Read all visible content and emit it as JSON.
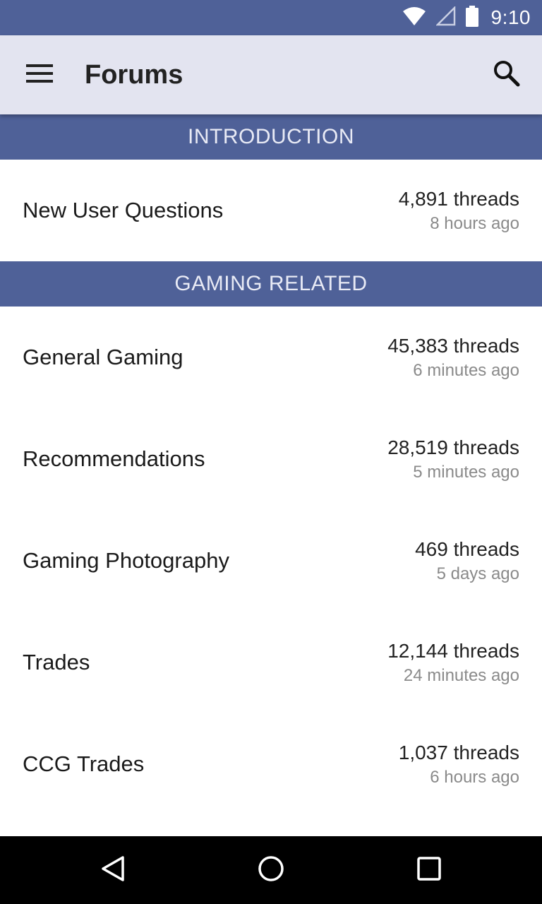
{
  "status_bar": {
    "time": "9:10",
    "icons": [
      "wifi-icon",
      "cell-signal-icon",
      "battery-icon"
    ]
  },
  "app_bar": {
    "title": "Forums",
    "menu_icon": "hamburger-menu-icon",
    "search_icon": "search-icon"
  },
  "colors": {
    "primary": "#4f6198",
    "app_bar_bg": "#e3e4f0",
    "secondary_text": "#8a8a8a"
  },
  "sections": [
    {
      "title": "INTRODUCTION",
      "forums": [
        {
          "name": "New User Questions",
          "threads": "4,891 threads",
          "last_post": "8 hours ago"
        }
      ]
    },
    {
      "title": "GAMING RELATED",
      "forums": [
        {
          "name": "General Gaming",
          "threads": "45,383 threads",
          "last_post": "6 minutes ago"
        },
        {
          "name": "Recommendations",
          "threads": "28,519 threads",
          "last_post": "5 minutes ago"
        },
        {
          "name": "Gaming Photography",
          "threads": "469 threads",
          "last_post": "5 days ago"
        },
        {
          "name": "Trades",
          "threads": "12,144 threads",
          "last_post": "24 minutes ago"
        },
        {
          "name": "CCG Trades",
          "threads": "1,037 threads",
          "last_post": "6 hours ago"
        }
      ]
    }
  ],
  "nav_bar": {
    "icons": [
      "back-icon",
      "home-icon",
      "recents-icon"
    ]
  }
}
